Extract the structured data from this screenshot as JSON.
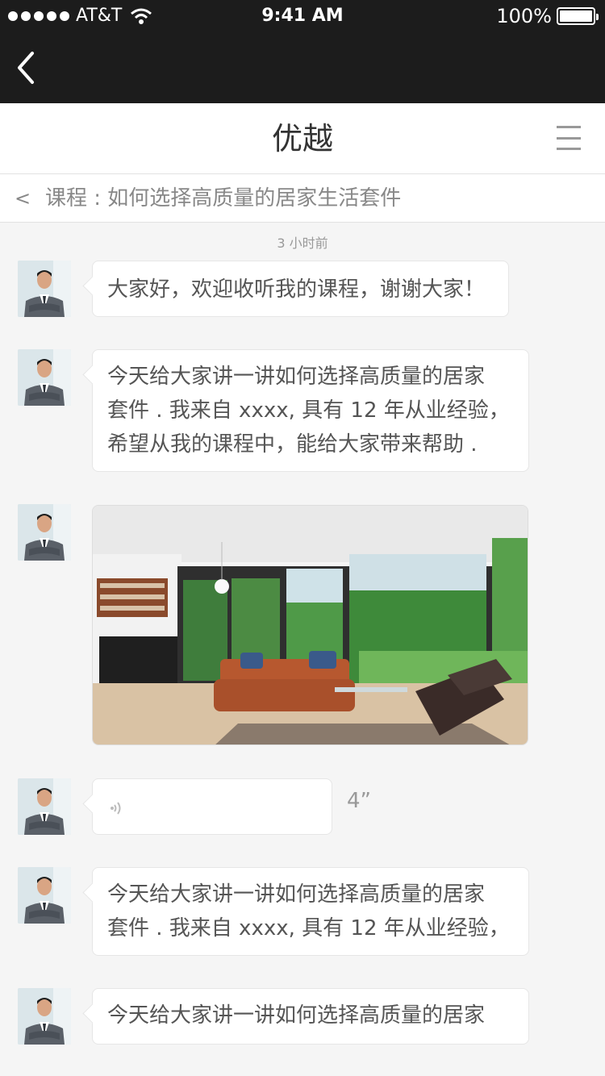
{
  "status_bar": {
    "carrier": "AT&T",
    "time": "9:41 AM",
    "battery": "100%"
  },
  "header": {
    "title": "优越"
  },
  "course": {
    "chevron": "<",
    "label": "课程 : 如何选择高质量的居家生活套件"
  },
  "chat": {
    "timestamp": "3 小时前",
    "messages": [
      {
        "type": "text",
        "lines": [
          "大家好，欢迎收听我的课程，谢谢大家！"
        ]
      },
      {
        "type": "text",
        "lines": [
          "今天给大家讲一讲如何选择高质量的居家",
          "套件 . 我来自 xxxx, 具有 12 年从业经验，",
          "希望从我的课程中，能给大家带来帮助 ."
        ]
      },
      {
        "type": "image",
        "description_icon": "living-room-photo"
      },
      {
        "type": "voice",
        "duration": "4”"
      },
      {
        "type": "text",
        "lines": [
          "今天给大家讲一讲如何选择高质量的居家",
          "套件 . 我来自 xxxx, 具有 12 年从业经验，"
        ]
      },
      {
        "type": "text",
        "lines": [
          "今天给大家讲一讲如何选择高质量的居家"
        ]
      }
    ]
  },
  "colors": {
    "topbar": "#1c1c1c",
    "background": "#f5f5f5",
    "bubble": "#ffffff"
  }
}
